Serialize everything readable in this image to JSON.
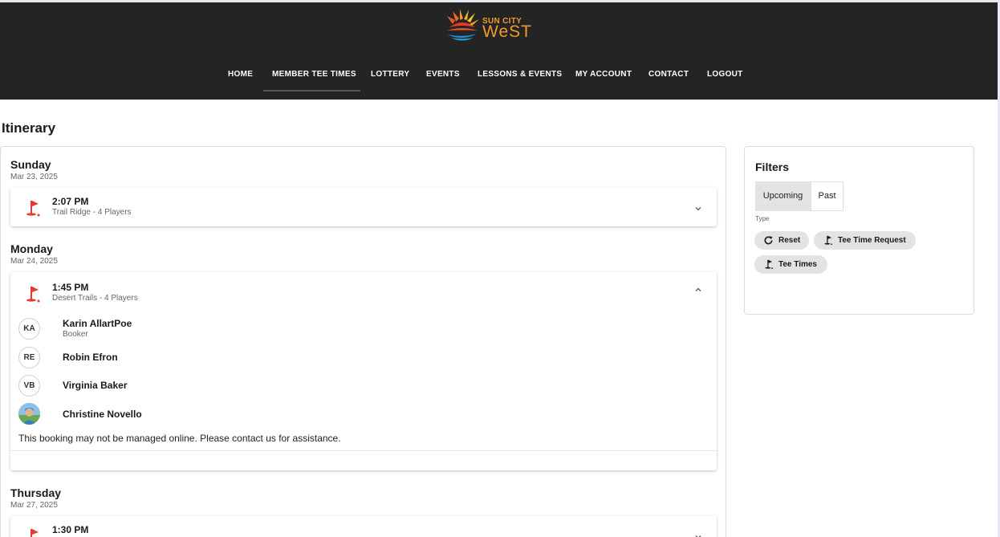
{
  "brand": {
    "line1": "SUN CITY",
    "line2": "WeST"
  },
  "nav": {
    "items": [
      "HOME",
      "MEMBER TEE TIMES",
      "LOTTERY",
      "EVENTS",
      "LESSONS & EVENTS",
      "MY ACCOUNT",
      "CONTACT",
      "LOGOUT"
    ],
    "active": "MEMBER TEE TIMES"
  },
  "page": {
    "title": "Itinerary"
  },
  "itinerary": {
    "days": [
      {
        "day": "Sunday",
        "date": "Mar 23, 2025",
        "tee_time": "2:07 PM",
        "details": "Trail Ridge - 4 Players",
        "expanded": false
      },
      {
        "day": "Monday",
        "date": "Mar 24, 2025",
        "tee_time": "1:45 PM",
        "details": "Desert Trails - 4 Players",
        "expanded": true,
        "players": [
          {
            "initials": "KA",
            "name": "Karin AllartPoe",
            "role": "Booker"
          },
          {
            "initials": "RE",
            "name": "Robin Efron",
            "role": ""
          },
          {
            "initials": "VB",
            "name": "Virginia Baker",
            "role": ""
          },
          {
            "initials": "",
            "name": "Christine Novello",
            "role": "",
            "photo": true
          }
        ],
        "notice": "This booking may not be managed online. Please contact us for assistance."
      },
      {
        "day": "Thursday",
        "date": "Mar 27, 2025",
        "tee_time": "1:30 PM",
        "details": "",
        "expanded": false
      }
    ]
  },
  "filters": {
    "title": "Filters",
    "tabs": [
      "Upcoming",
      "Past"
    ],
    "selected_tab": "Upcoming",
    "type_label": "Type",
    "chips": [
      "Reset",
      "Tee Time Request",
      "Tee Times"
    ]
  },
  "colors": {
    "header_bg": "#242424",
    "flag_red": "#e53935",
    "brand_orange": "#f09a2a",
    "brand_blue": "#1e90d6",
    "chip_bg": "#e3e3e3"
  },
  "icons": {
    "tee_time": "golf-flag-icon",
    "collapse": "chevron-down-icon",
    "expand": "chevron-up-icon",
    "reset": "refresh-icon"
  }
}
